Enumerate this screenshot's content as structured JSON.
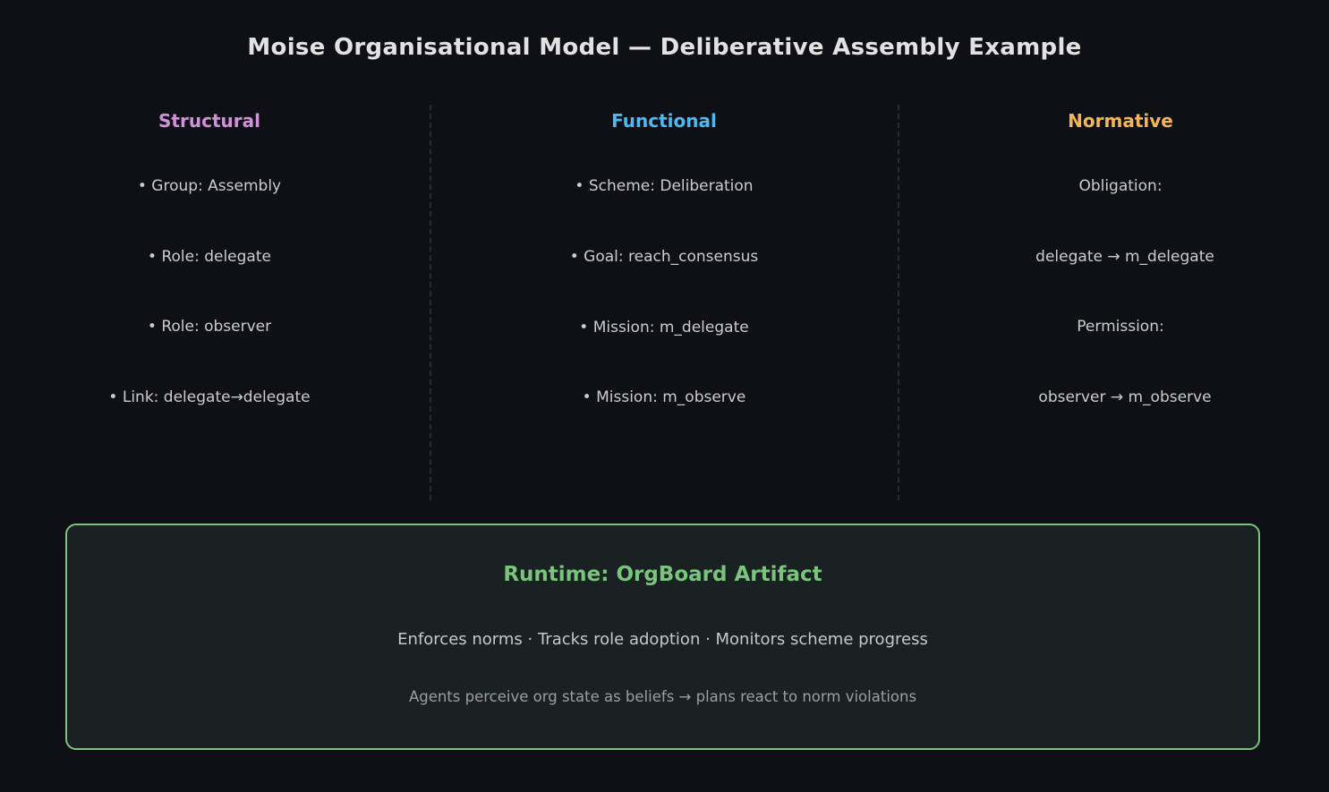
{
  "title": "Moise Organisational Model — Deliberative Assembly Example",
  "colors": {
    "background": "#0f1015",
    "structural": "#d48fdc",
    "functional": "#4fb8f0",
    "normative": "#f5b556",
    "runtime": "#7ac47d"
  },
  "columns": [
    {
      "heading": "Structural",
      "items": [
        "• Group: Assembly",
        "• Role: delegate",
        "• Role: observer",
        "• Link: delegate→delegate"
      ]
    },
    {
      "heading": "Functional",
      "items": [
        "• Scheme: Deliberation",
        "• Goal: reach_consensus",
        "• Mission: m_delegate",
        "• Mission: m_observe"
      ]
    },
    {
      "heading": "Normative",
      "items": [
        "Obligation:",
        "delegate → m_delegate",
        "Permission:",
        "observer → m_observe"
      ]
    }
  ],
  "runtime": {
    "title": "Runtime: OrgBoard Artifact",
    "line1": "Enforces norms · Tracks role adoption · Monitors scheme progress",
    "line2": "Agents perceive org state as beliefs → plans react to norm violations"
  }
}
